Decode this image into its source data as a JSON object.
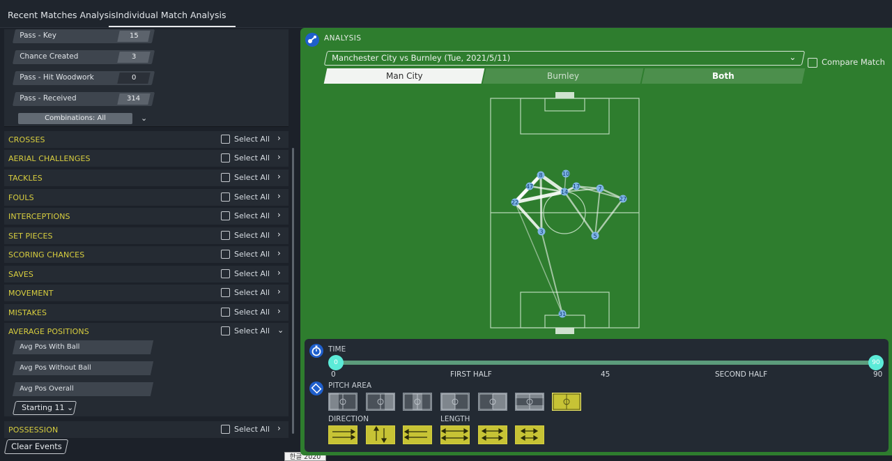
{
  "tabs": [
    "Recent Matches Analysis",
    "Individual Match Analysis"
  ],
  "metrics": [
    {
      "label": "Pass - Key",
      "value": "15"
    },
    {
      "label": "Chance Created",
      "value": "3"
    },
    {
      "label": "Pass - Hit Woodwork",
      "value": "0"
    },
    {
      "label": "Pass - Received",
      "value": "314"
    }
  ],
  "combinations": "Combinations: All",
  "select_all": "Select All",
  "sections": [
    "CROSSES",
    "AERIAL CHALLENGES",
    "TACKLES",
    "FOULS",
    "INTERCEPTIONS",
    "SET PIECES",
    "SCORING CHANCES",
    "SAVES",
    "MOVEMENT",
    "MISTAKES",
    "AVERAGE POSITIONS",
    "POSSESSION"
  ],
  "avg_positions": [
    "Avg Pos With Ball",
    "Avg Pos Without Ball",
    "Avg Pos Overall"
  ],
  "starting": "Starting 11",
  "clear_events": "Clear Events",
  "ime_badge": "한글 2020",
  "analysis": {
    "title": "ANALYSIS",
    "match": "Manchester City vs Burnley (Tue, 2021/5/11)",
    "compare": "Compare Match",
    "team_tabs": [
      "Man City",
      "Burnley",
      "Both"
    ],
    "selected_team": "Man City"
  },
  "players": [
    {
      "num": "8"
    },
    {
      "num": "10"
    },
    {
      "num": "47"
    },
    {
      "num": "17"
    },
    {
      "num": "7"
    },
    {
      "num": "27"
    },
    {
      "num": "14"
    },
    {
      "num": "22"
    },
    {
      "num": "3"
    },
    {
      "num": "5"
    },
    {
      "num": "31"
    }
  ],
  "filters": {
    "time_label": "TIME",
    "time_min": "0",
    "time_max": "90",
    "ticks": [
      "0",
      "FIRST HALF",
      "45",
      "SECOND HALF",
      "90"
    ],
    "pitch_area_label": "PITCH AREA",
    "pitch_area_selected_index": 6,
    "direction_label": "DIRECTION",
    "length_label": "LENGTH"
  }
}
